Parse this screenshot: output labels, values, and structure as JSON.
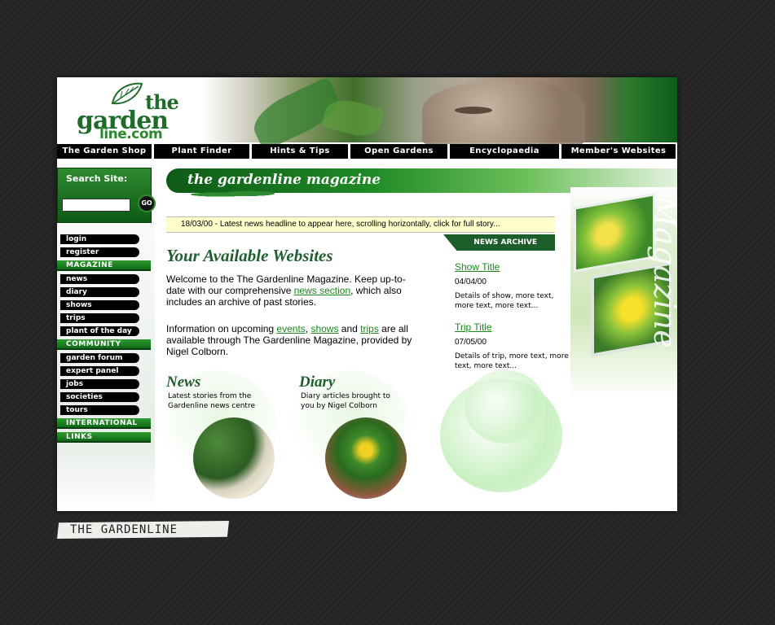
{
  "header": {
    "logo_the": "the",
    "logo_garden": "garden",
    "logo_com": "line.com"
  },
  "nav": [
    {
      "label": "The Garden Shop",
      "width": 116
    },
    {
      "label": "Plant Finder",
      "width": 117
    },
    {
      "label": "Hints & Tips",
      "width": 118
    },
    {
      "label": "Open Gardens",
      "width": 119
    },
    {
      "label": "Encyclopaedia",
      "width": 134
    },
    {
      "label": "Member's Websites",
      "width": 140
    }
  ],
  "sidebar": {
    "search_label": "Search Site:",
    "search_value": "",
    "go_label": "GO",
    "menu": [
      {
        "type": "item",
        "label": "login"
      },
      {
        "type": "item",
        "label": "register"
      },
      {
        "type": "sec",
        "label": "MAGAZINE"
      },
      {
        "type": "item",
        "label": "news"
      },
      {
        "type": "item",
        "label": "diary"
      },
      {
        "type": "item",
        "label": "shows"
      },
      {
        "type": "item",
        "label": "trips"
      },
      {
        "type": "item",
        "label": "plant of the day"
      },
      {
        "type": "sec",
        "label": "COMMUNITY"
      },
      {
        "type": "item",
        "label": "garden forum"
      },
      {
        "type": "item",
        "label": "expert panel"
      },
      {
        "type": "item",
        "label": "jobs"
      },
      {
        "type": "item",
        "label": "societies"
      },
      {
        "type": "item",
        "label": "tours"
      },
      {
        "type": "sec",
        "label": "INTERNATIONAL"
      },
      {
        "type": "sec",
        "label": "LINKS"
      }
    ]
  },
  "main": {
    "magazine_banner": "the gardenline magazine",
    "ticker": "18/03/00 - Latest news headline to appear here, scrolling horizontally, click for full story...",
    "archive_tab": "NEWS ARCHIVE",
    "title": "Your Available Websites",
    "para1": {
      "before": "Welcome to the The Gardenline Magazine. Keep up-to-date with our comprehensive ",
      "link": "news section",
      "after": ", which also includes an archive of past stories."
    },
    "para2": {
      "before": "Information on upcoming ",
      "link1": "events",
      "sep1": ", ",
      "link2": "shows",
      "sep2": " and ",
      "link3": "trips",
      "after": " are all available through The Gardenline Magazine, provided by Nigel Colborn."
    },
    "archive": [
      {
        "title": "Show Title",
        "date": "04/04/00",
        "detail": "Details of show, more text, more text, more text..."
      },
      {
        "title": "Trip Title",
        "date": "07/05/00",
        "detail": "Details of trip, more text, more text, more text..."
      }
    ],
    "features": [
      {
        "title": "News",
        "text": "Latest stories from the Gardenline news centre"
      },
      {
        "title": "Diary",
        "text": "Diary articles brought to you by Nigel Colborn"
      }
    ],
    "side_art_word": "Magazine"
  },
  "footer_tape": "THE GARDENLINE"
}
